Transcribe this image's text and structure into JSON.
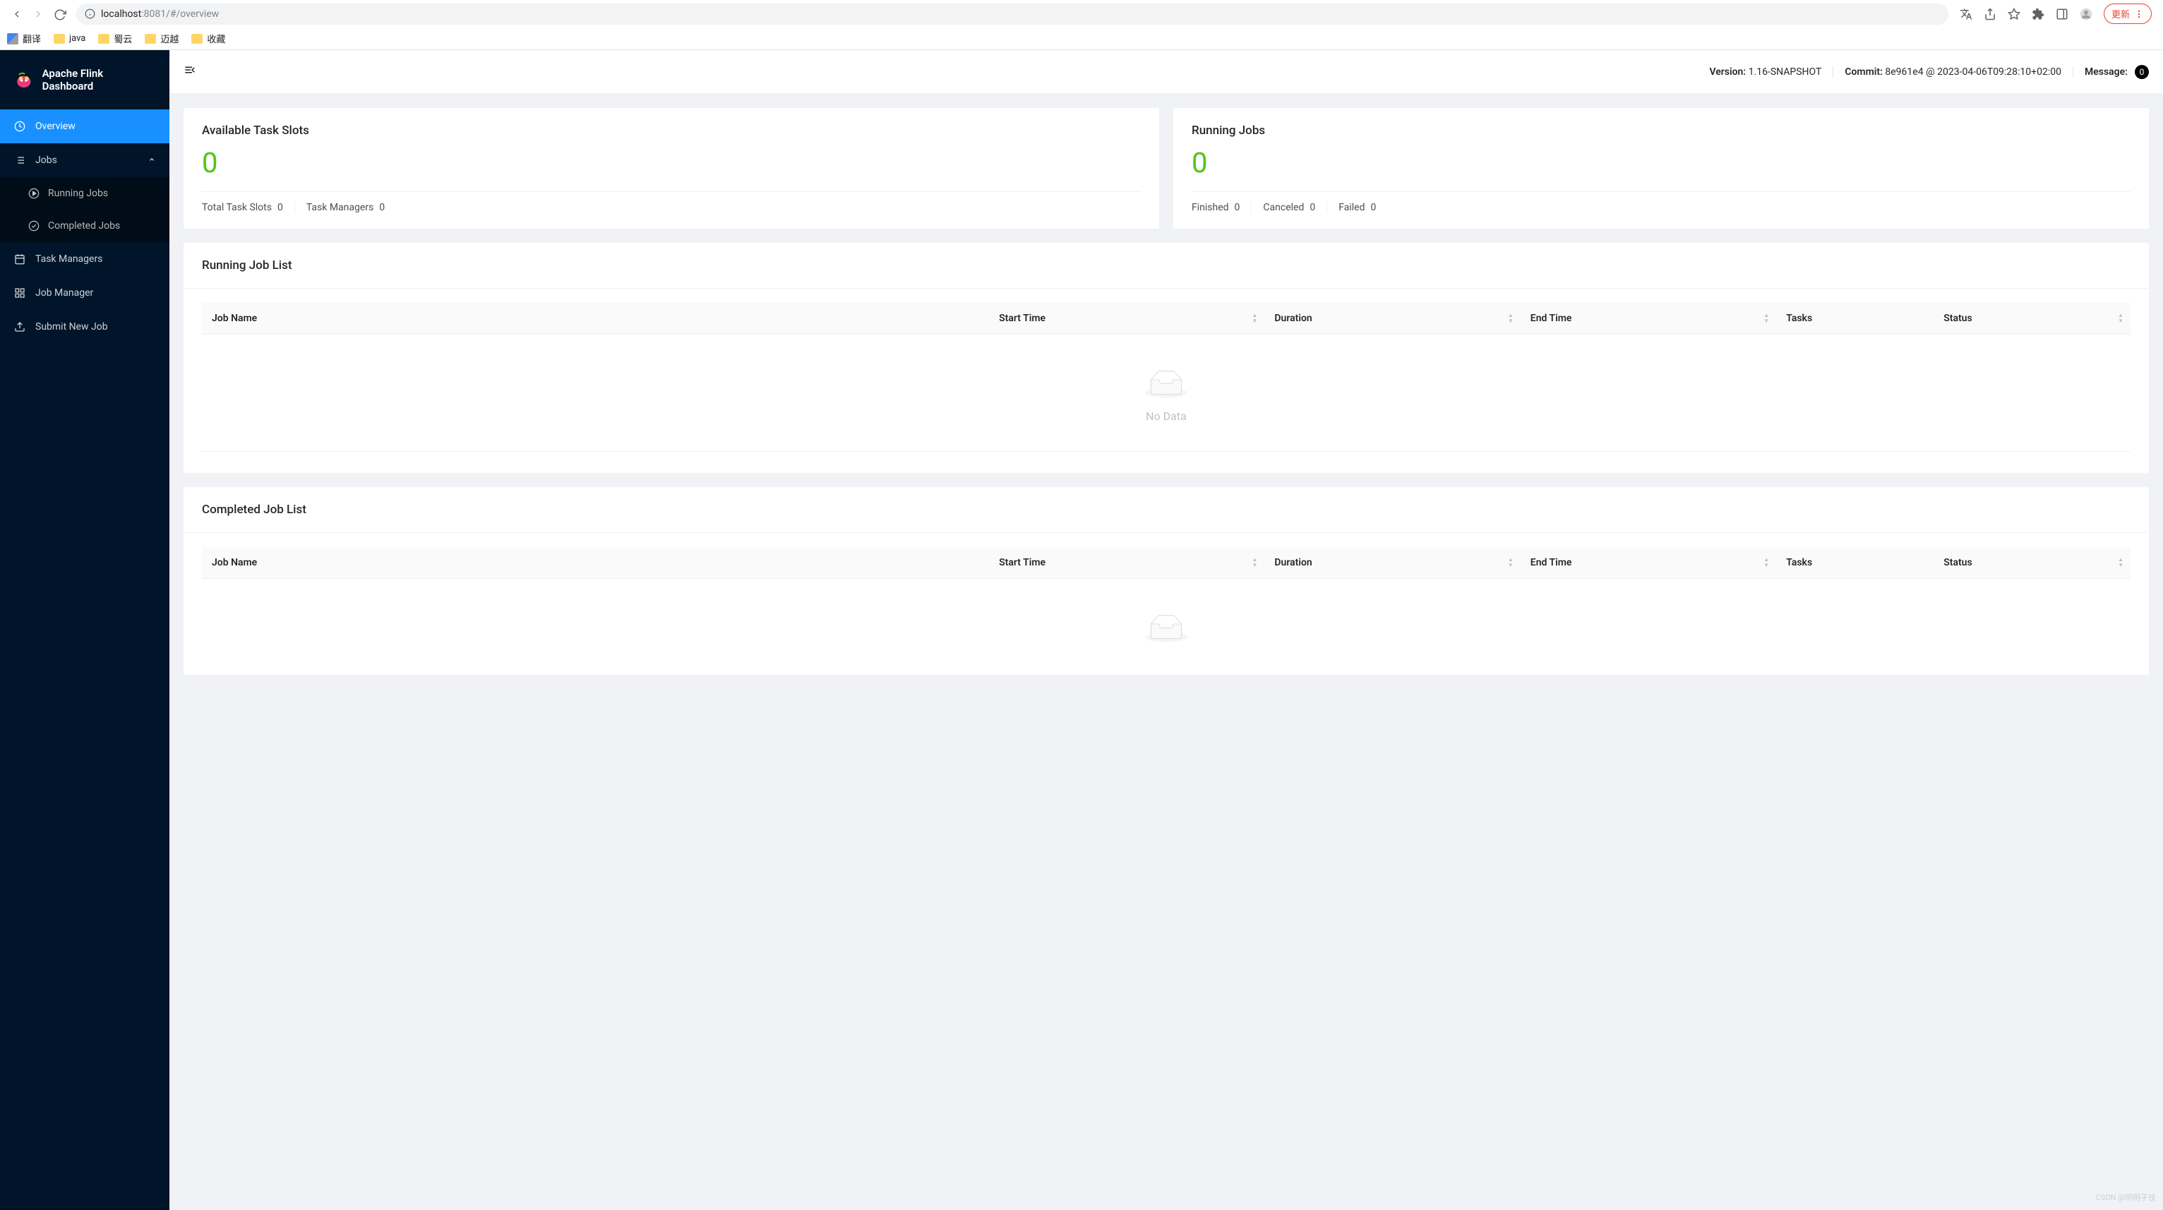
{
  "browser": {
    "url_host": "localhost",
    "url_port_path": ":8081/#/overview",
    "update_label": "更新",
    "bookmarks": [
      {
        "label": "翻译",
        "icon": "translate"
      },
      {
        "label": "java",
        "icon": "folder"
      },
      {
        "label": "蜀云",
        "icon": "folder"
      },
      {
        "label": "迈越",
        "icon": "folder"
      },
      {
        "label": "收藏",
        "icon": "folder"
      }
    ]
  },
  "sidebar": {
    "title": "Apache Flink Dashboard",
    "items": {
      "overview": "Overview",
      "jobs": "Jobs",
      "running_jobs": "Running Jobs",
      "completed_jobs": "Completed Jobs",
      "task_managers": "Task Managers",
      "job_manager": "Job Manager",
      "submit_new_job": "Submit New Job"
    }
  },
  "header": {
    "version_label": "Version:",
    "version_value": "1.16-SNAPSHOT",
    "commit_label": "Commit:",
    "commit_hash": "8e961e4",
    "commit_at": "@",
    "commit_time": "2023-04-06T09:28:10+02:00",
    "message_label": "Message:",
    "message_count": "0"
  },
  "stats": {
    "slots": {
      "title": "Available Task Slots",
      "value": "0",
      "total_label": "Total Task Slots",
      "total_value": "0",
      "tm_label": "Task Managers",
      "tm_value": "0"
    },
    "running": {
      "title": "Running Jobs",
      "value": "0",
      "finished_label": "Finished",
      "finished_value": "0",
      "canceled_label": "Canceled",
      "canceled_value": "0",
      "failed_label": "Failed",
      "failed_value": "0"
    }
  },
  "sections": {
    "running_title": "Running Job List",
    "completed_title": "Completed Job List"
  },
  "columns": {
    "job_name": "Job Name",
    "start_time": "Start Time",
    "duration": "Duration",
    "end_time": "End Time",
    "tasks": "Tasks",
    "status": "Status"
  },
  "empty": "No Data",
  "watermark": "CSDN @明明子技"
}
